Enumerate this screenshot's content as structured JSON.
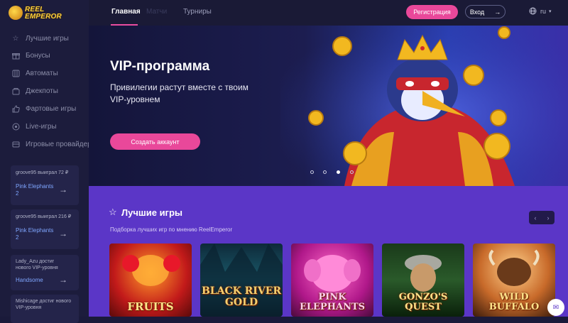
{
  "brand": {
    "line1": "REEL",
    "line2": "EMPEROR"
  },
  "sidebar": {
    "items": [
      {
        "label": "Лучшие игры",
        "icon": "star-icon"
      },
      {
        "label": "Бонусы",
        "icon": "gift-icon"
      },
      {
        "label": "Автоматы",
        "icon": "slot-icon"
      },
      {
        "label": "Джекпоты",
        "icon": "jackpot-icon"
      },
      {
        "label": "Фартовые игры",
        "icon": "thumb-up-icon"
      },
      {
        "label": "Live-игры",
        "icon": "live-icon"
      },
      {
        "label": "Игровые провайдеры",
        "icon": "providers-icon"
      }
    ],
    "wins": [
      {
        "who": "groove95 выиграл 72 ₽",
        "game": "Pink Elephants 2"
      },
      {
        "who": "groove95 выиграл 216 ₽",
        "game": "Pink Elephants 2"
      },
      {
        "who": "Lady_Azu достиг нового VIP-уровня",
        "game": "Handsome"
      },
      {
        "who": "Mishicage достиг нового VIP-уровня",
        "game": ""
      }
    ]
  },
  "topbar": {
    "tabs": [
      "Главная",
      "Матчи",
      "Турниры"
    ],
    "register_label": "Регистрация",
    "login_label": "Вход",
    "lang": "ru"
  },
  "hero": {
    "title": "VIP-программа",
    "subtitle": "Привилегии растут вместе с твоим VIP-уровнем",
    "cta_label": "Создать аккаунт",
    "slides_total": 4,
    "slide_active": 3
  },
  "best_games": {
    "title": "Лучшие игры",
    "subtitle": "Подборка лучших игр по мнению ReelEmperor",
    "games": [
      {
        "name": "FRUITS"
      },
      {
        "name": "BLACK RIVER GOLD"
      },
      {
        "name": "PINK ELEPHANTS"
      },
      {
        "name": "GONZO'S QUEST"
      },
      {
        "name": "WILD BUFFALO"
      }
    ]
  },
  "colors": {
    "accent": "#e9489a",
    "sidebar_bg": "#1c1c3c",
    "section_bg": "#5b36c7"
  }
}
